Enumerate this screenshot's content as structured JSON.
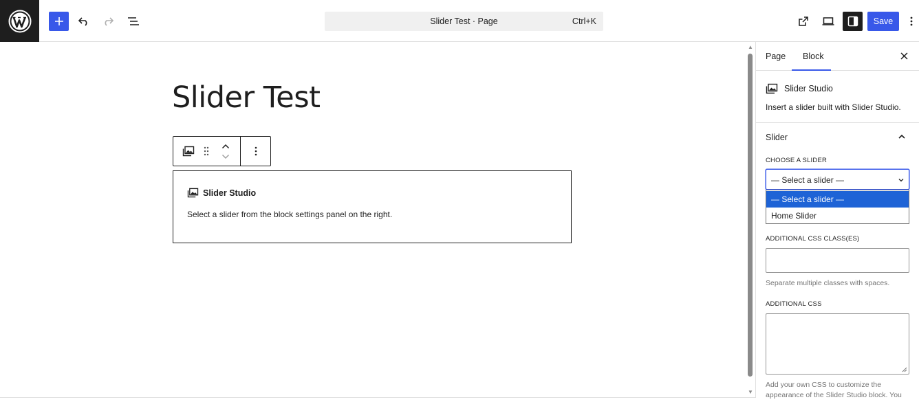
{
  "header": {
    "document_title": "Slider Test · Page",
    "shortcut": "Ctrl+K",
    "save_label": "Save"
  },
  "editor": {
    "page_title": "Slider Test",
    "block": {
      "name": "Slider Studio",
      "placeholder_text": "Select a slider from the block settings panel on the right."
    }
  },
  "sidebar": {
    "tabs": [
      {
        "label": "Page",
        "active": false
      },
      {
        "label": "Block",
        "active": true
      }
    ],
    "block_card": {
      "title": "Slider Studio",
      "description": "Insert a slider built with Slider Studio."
    },
    "panel_title": "Slider",
    "choose_label": "Choose a slider",
    "select_value": "— Select a slider —",
    "options": [
      "— Select a slider —",
      "Home Slider"
    ],
    "css_class_label": "Additional CSS class(es)",
    "css_class_help": "Separate multiple classes with spaces.",
    "additional_css_label": "Additional CSS",
    "additional_css_help": "Add your own CSS to customize the appearance of the Slider Studio block. You"
  },
  "colors": {
    "accent": "#3858e9",
    "dark": "#1e1e1e",
    "option_highlight": "#1e63d6"
  }
}
